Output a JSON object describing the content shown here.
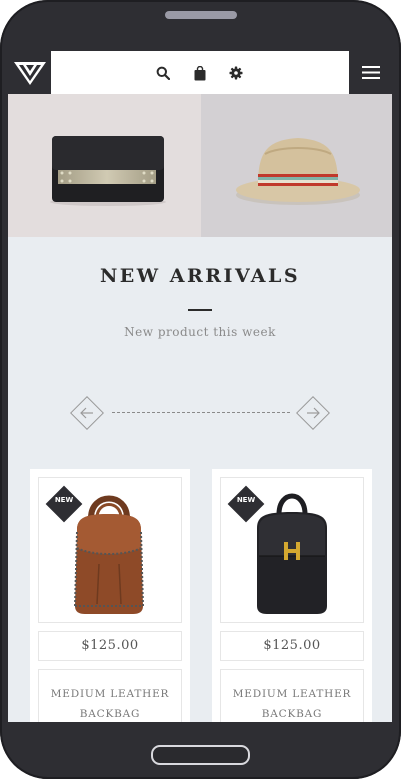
{
  "toolbar": {
    "logo_icon": "triangle-logo-icon",
    "search_icon": "search-icon",
    "bag_icon": "shopping-bag-icon",
    "settings_icon": "gear-icon",
    "menu_icon": "hamburger-menu-icon"
  },
  "banners": [
    {
      "icon": "clutch-bag-image"
    },
    {
      "icon": "fedora-hat-image"
    }
  ],
  "section": {
    "title": "NEW ARRIVALS",
    "subtitle": "New product this week"
  },
  "slider": {
    "prev_icon": "arrow-left-icon",
    "next_icon": "arrow-right-icon"
  },
  "products": [
    {
      "badge": "NEW",
      "price": "$125.00",
      "name": "MEDIUM LEATHER BACKBAG",
      "image": "brown-backpack-image"
    },
    {
      "badge": "NEW",
      "price": "$125.00",
      "name": "MEDIUM LEATHER BACKBAG",
      "image": "black-backpack-image"
    }
  ],
  "colors": {
    "frame": "#2e2e33",
    "page_bg": "#e9edf1",
    "title": "#2b2b2b",
    "muted": "#8a8a8a"
  }
}
